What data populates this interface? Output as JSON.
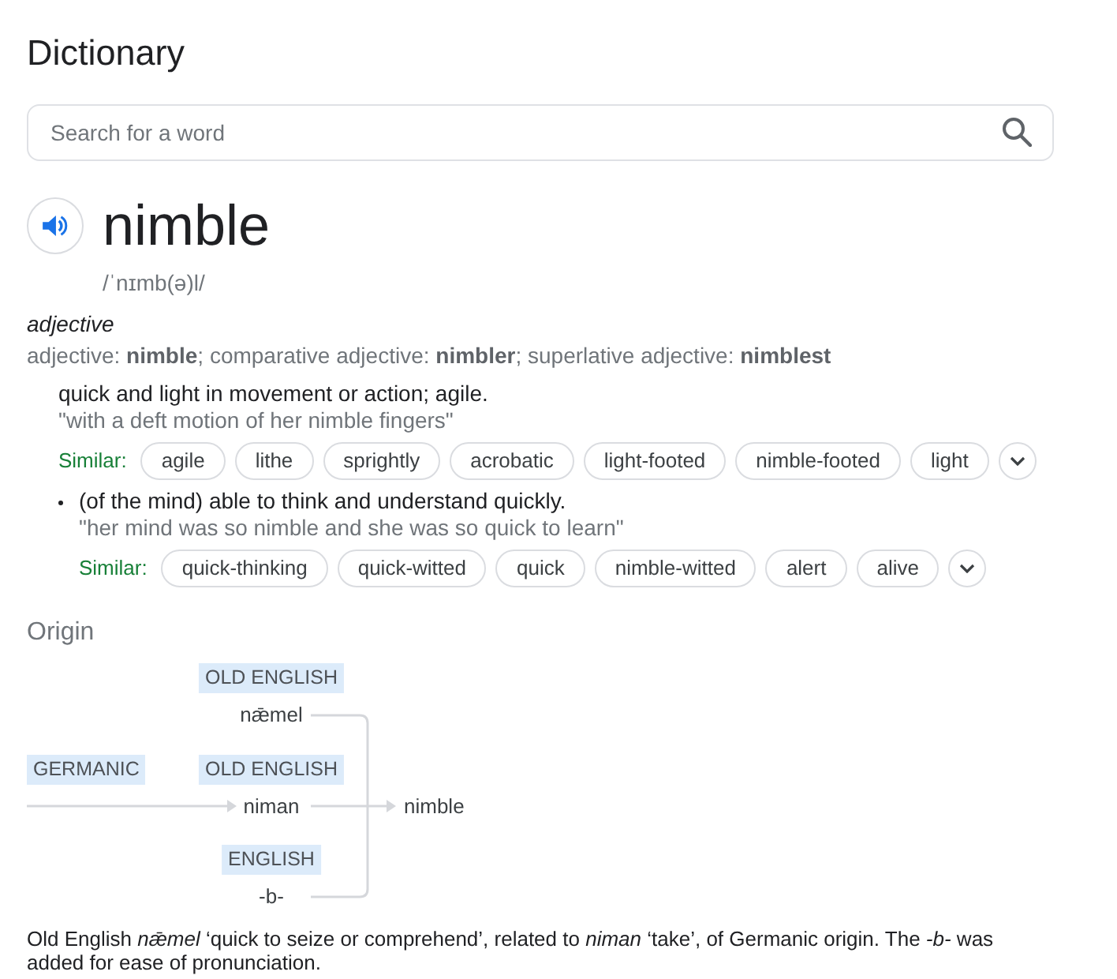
{
  "title": "Dictionary",
  "search": {
    "placeholder": "Search for a word"
  },
  "entry": {
    "word": "nimble",
    "phonetic": "/ˈnɪmb(ə)l/",
    "part_of_speech": "adjective",
    "forms": "adjective: **nimble**; comparative adjective: **nimbler**; superlative adjective: **nimblest**",
    "senses": [
      {
        "definition": "quick and light in movement or action; agile.",
        "example": "\"with a deft motion of her nimble fingers\"",
        "similar": {
          "label": "Similar:",
          "words": [
            "agile",
            "lithe",
            "sprightly",
            "acrobatic",
            "light-footed",
            "nimble-footed",
            "light"
          ],
          "expanded": false
        },
        "subsenses": [
          {
            "definition": "(of the mind) able to think and understand quickly.",
            "example": "\"her mind was so nimble and she was so quick to learn\"",
            "similar": {
              "label": "Similar:",
              "words": [
                "quick-thinking",
                "quick-witted",
                "quick",
                "nimble-witted",
                "alert",
                "alive"
              ],
              "expanded": false
            }
          }
        ]
      }
    ]
  },
  "origin": {
    "heading": "Origin",
    "diagram": {
      "rows": [
        {
          "language": "OLD ENGLISH",
          "word": "nǣmel"
        },
        {
          "source_language": "GERMANIC",
          "language": "OLD ENGLISH",
          "word": "niman"
        },
        {
          "language": "ENGLISH",
          "word": "-b-"
        }
      ],
      "result": "nimble"
    },
    "note": "Old English *nǣmel* ‘quick to seize or comprehend’, related to *niman* ‘take’, of Germanic origin. The *-b-* was added for ease of pronunciation."
  }
}
